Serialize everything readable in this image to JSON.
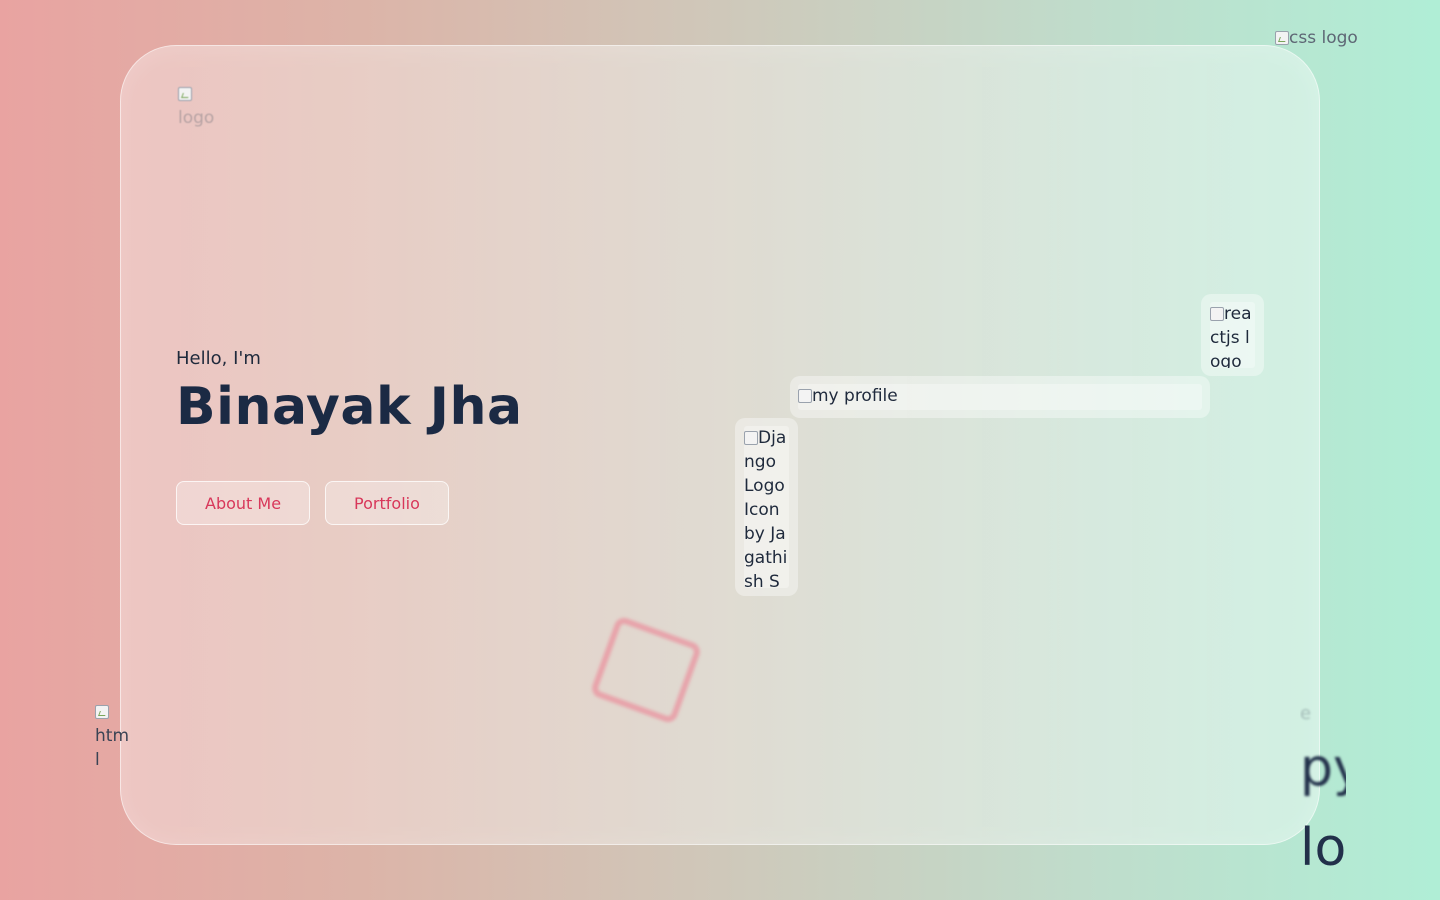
{
  "images": {
    "css_logo": {
      "alt": "css logo",
      "icon": "broken-image-icon"
    },
    "card_logo": {
      "alt": "logo",
      "icon": "broken-image-icon"
    },
    "react_logo": {
      "alt": "reactjs logo",
      "icon": "broken-image-icon"
    },
    "profile": {
      "alt": "my profile",
      "icon": "broken-image-icon"
    },
    "django_logo": {
      "alt": "Django Logo Icon by Jagathish Saravanan",
      "icon": "broken-image-icon"
    },
    "html_logo": {
      "alt": "html logo",
      "icon": "broken-image-icon"
    },
    "python_logo": {
      "alt_small": "e",
      "alt_line1": "py",
      "alt_line2": "lo"
    }
  },
  "hero": {
    "greeting": "Hello, I'm",
    "name": "Binayak Jha"
  },
  "actions": {
    "about_label": "About Me",
    "portfolio_label": "Portfolio"
  },
  "colors": {
    "accent": "#d8375a",
    "heading": "#1b2a44",
    "bg_left": "#e9a3a1",
    "bg_right": "#b0eed6"
  }
}
